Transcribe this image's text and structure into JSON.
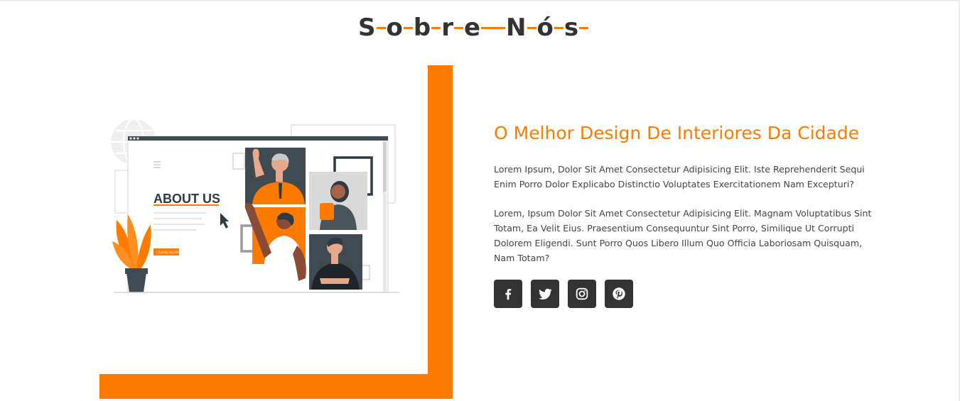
{
  "section_title": {
    "text": "Sobre Nós",
    "accent_color": "#ff7b00",
    "text_color": "#333333"
  },
  "illustration": {
    "heading": "ABOUT US",
    "button_label": "LEARN MORE"
  },
  "about": {
    "headline": "O Melhor Design De Interiores Da Cidade",
    "paragraph_1": "Lorem Ipsum, Dolor Sit Amet Consectetur Adipisicing Elit. Iste Reprehenderit Sequi Enim Porro Dolor Explicabo Distinctio Voluptates Exercitationem Nam Excepturi?",
    "paragraph_2": "Lorem, Ipsum Dolor Sit Amet Consectetur Adipisicing Elit. Magnam Voluptatibus Sint Totam, Ea Velit Eius. Praesentium Consequuntur Sint Porro, Similique Ut Corrupti Dolorem Eligendi. Sunt Porro Quos Libero Illum Quo Officia Laboriosam Quisquam, Nam Totam?"
  },
  "socials": [
    {
      "name": "facebook",
      "icon": "facebook-icon"
    },
    {
      "name": "twitter",
      "icon": "twitter-icon"
    },
    {
      "name": "instagram",
      "icon": "instagram-icon"
    },
    {
      "name": "pinterest",
      "icon": "pinterest-icon"
    }
  ],
  "colors": {
    "accent": "#ff7b00",
    "dark": "#333333",
    "slate": "#3f4a52"
  }
}
